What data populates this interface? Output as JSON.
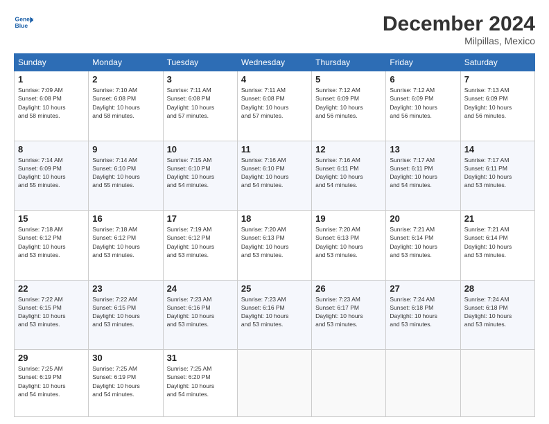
{
  "header": {
    "logo_line1": "General",
    "logo_line2": "Blue",
    "month": "December 2024",
    "location": "Milpillas, Mexico"
  },
  "weekdays": [
    "Sunday",
    "Monday",
    "Tuesday",
    "Wednesday",
    "Thursday",
    "Friday",
    "Saturday"
  ],
  "weeks": [
    [
      {
        "day": 1,
        "info": "Sunrise: 7:09 AM\nSunset: 6:08 PM\nDaylight: 10 hours\nand 58 minutes."
      },
      {
        "day": 2,
        "info": "Sunrise: 7:10 AM\nSunset: 6:08 PM\nDaylight: 10 hours\nand 58 minutes."
      },
      {
        "day": 3,
        "info": "Sunrise: 7:11 AM\nSunset: 6:08 PM\nDaylight: 10 hours\nand 57 minutes."
      },
      {
        "day": 4,
        "info": "Sunrise: 7:11 AM\nSunset: 6:08 PM\nDaylight: 10 hours\nand 57 minutes."
      },
      {
        "day": 5,
        "info": "Sunrise: 7:12 AM\nSunset: 6:09 PM\nDaylight: 10 hours\nand 56 minutes."
      },
      {
        "day": 6,
        "info": "Sunrise: 7:12 AM\nSunset: 6:09 PM\nDaylight: 10 hours\nand 56 minutes."
      },
      {
        "day": 7,
        "info": "Sunrise: 7:13 AM\nSunset: 6:09 PM\nDaylight: 10 hours\nand 56 minutes."
      }
    ],
    [
      {
        "day": 8,
        "info": "Sunrise: 7:14 AM\nSunset: 6:09 PM\nDaylight: 10 hours\nand 55 minutes."
      },
      {
        "day": 9,
        "info": "Sunrise: 7:14 AM\nSunset: 6:10 PM\nDaylight: 10 hours\nand 55 minutes."
      },
      {
        "day": 10,
        "info": "Sunrise: 7:15 AM\nSunset: 6:10 PM\nDaylight: 10 hours\nand 54 minutes."
      },
      {
        "day": 11,
        "info": "Sunrise: 7:16 AM\nSunset: 6:10 PM\nDaylight: 10 hours\nand 54 minutes."
      },
      {
        "day": 12,
        "info": "Sunrise: 7:16 AM\nSunset: 6:11 PM\nDaylight: 10 hours\nand 54 minutes."
      },
      {
        "day": 13,
        "info": "Sunrise: 7:17 AM\nSunset: 6:11 PM\nDaylight: 10 hours\nand 54 minutes."
      },
      {
        "day": 14,
        "info": "Sunrise: 7:17 AM\nSunset: 6:11 PM\nDaylight: 10 hours\nand 53 minutes."
      }
    ],
    [
      {
        "day": 15,
        "info": "Sunrise: 7:18 AM\nSunset: 6:12 PM\nDaylight: 10 hours\nand 53 minutes."
      },
      {
        "day": 16,
        "info": "Sunrise: 7:18 AM\nSunset: 6:12 PM\nDaylight: 10 hours\nand 53 minutes."
      },
      {
        "day": 17,
        "info": "Sunrise: 7:19 AM\nSunset: 6:12 PM\nDaylight: 10 hours\nand 53 minutes."
      },
      {
        "day": 18,
        "info": "Sunrise: 7:20 AM\nSunset: 6:13 PM\nDaylight: 10 hours\nand 53 minutes."
      },
      {
        "day": 19,
        "info": "Sunrise: 7:20 AM\nSunset: 6:13 PM\nDaylight: 10 hours\nand 53 minutes."
      },
      {
        "day": 20,
        "info": "Sunrise: 7:21 AM\nSunset: 6:14 PM\nDaylight: 10 hours\nand 53 minutes."
      },
      {
        "day": 21,
        "info": "Sunrise: 7:21 AM\nSunset: 6:14 PM\nDaylight: 10 hours\nand 53 minutes."
      }
    ],
    [
      {
        "day": 22,
        "info": "Sunrise: 7:22 AM\nSunset: 6:15 PM\nDaylight: 10 hours\nand 53 minutes."
      },
      {
        "day": 23,
        "info": "Sunrise: 7:22 AM\nSunset: 6:15 PM\nDaylight: 10 hours\nand 53 minutes."
      },
      {
        "day": 24,
        "info": "Sunrise: 7:23 AM\nSunset: 6:16 PM\nDaylight: 10 hours\nand 53 minutes."
      },
      {
        "day": 25,
        "info": "Sunrise: 7:23 AM\nSunset: 6:16 PM\nDaylight: 10 hours\nand 53 minutes."
      },
      {
        "day": 26,
        "info": "Sunrise: 7:23 AM\nSunset: 6:17 PM\nDaylight: 10 hours\nand 53 minutes."
      },
      {
        "day": 27,
        "info": "Sunrise: 7:24 AM\nSunset: 6:18 PM\nDaylight: 10 hours\nand 53 minutes."
      },
      {
        "day": 28,
        "info": "Sunrise: 7:24 AM\nSunset: 6:18 PM\nDaylight: 10 hours\nand 53 minutes."
      }
    ],
    [
      {
        "day": 29,
        "info": "Sunrise: 7:25 AM\nSunset: 6:19 PM\nDaylight: 10 hours\nand 54 minutes."
      },
      {
        "day": 30,
        "info": "Sunrise: 7:25 AM\nSunset: 6:19 PM\nDaylight: 10 hours\nand 54 minutes."
      },
      {
        "day": 31,
        "info": "Sunrise: 7:25 AM\nSunset: 6:20 PM\nDaylight: 10 hours\nand 54 minutes."
      },
      null,
      null,
      null,
      null
    ]
  ]
}
